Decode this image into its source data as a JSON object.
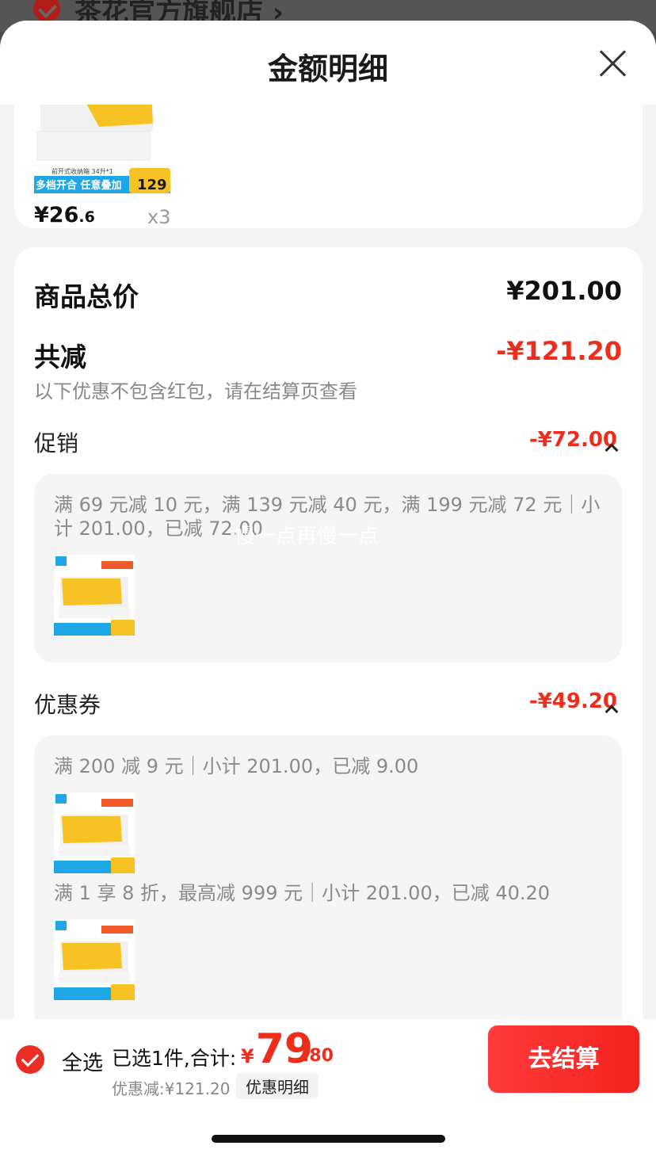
{
  "background": {
    "store_name": "茶花官方旗舰店 ›"
  },
  "sheet": {
    "title": "金额明细"
  },
  "item_card": {
    "thumb_caption": "前开式收纳箱 34升*1",
    "thumb_banner": "多档开合 任意叠加",
    "thumb_price_tag": "129",
    "price_main": "¥26",
    "price_decimal": ".6",
    "quantity": "x3"
  },
  "summary": {
    "total_label": "商品总价",
    "total_value": "¥201.00",
    "reduce_label": "共减",
    "reduce_value": "-¥121.20",
    "reduce_note": "以下优惠不包含红包，请在结算页查看"
  },
  "promotion": {
    "label": "促销",
    "value": "-¥72.00",
    "detail": "满 69 元减 10 元，满 139 元减 40 元，满 199 元减 72 元｜小计 201.00，已减 72.00"
  },
  "coupon": {
    "label": "优惠券",
    "value": "-¥49.20",
    "detail_1": "满 200 减 9 元｜小计 201.00，已减 9.00",
    "detail_2": "满 1 享 8 折，最高减 999 元｜小计 201.00，已减 40.20"
  },
  "watermark": "慢一点再慢一点",
  "bottom_bar": {
    "select_all": "全选",
    "summary_prefix": "已选1件,合计:",
    "currency": "¥",
    "total_int": "79",
    "total_dec": ".80",
    "discount_text": "优惠减:¥121.20",
    "discount_detail_btn": "优惠明细",
    "checkout": "去结算"
  },
  "colors": {
    "accent": "#ee2d1d",
    "product_yellow": "#f7c223"
  }
}
